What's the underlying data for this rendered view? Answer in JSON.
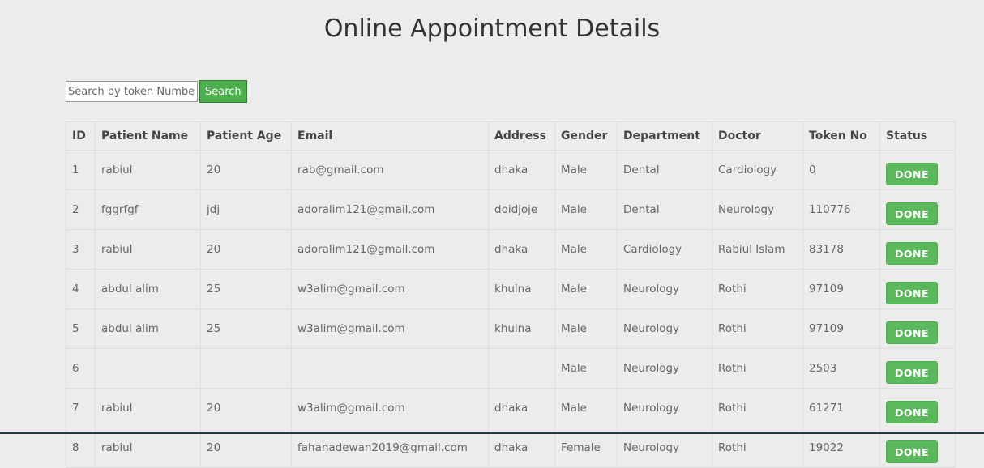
{
  "page": {
    "title": "Online Appointment Details"
  },
  "search": {
    "placeholder": "Search by token Number",
    "value": "",
    "button_label": "Search"
  },
  "table": {
    "columns": [
      "ID",
      "Patient Name",
      "Patient Age",
      "Email",
      "Address",
      "Gender",
      "Department",
      "Doctor",
      "Token No",
      "Status"
    ],
    "rows": [
      [
        "1",
        "rabiul",
        "20",
        "rab@gmail.com",
        "dhaka",
        "Male",
        "Dental",
        "Cardiology",
        "0",
        "DONE"
      ],
      [
        "2",
        "fggrfgf",
        "jdj",
        "adoralim121@gmail.com",
        "doidjoje",
        "Male",
        "Dental",
        "Neurology",
        "110776",
        "DONE"
      ],
      [
        "3",
        "rabiul",
        "20",
        "adoralim121@gmail.com",
        "dhaka",
        "Male",
        "Cardiology",
        "Rabiul Islam",
        "83178",
        "DONE"
      ],
      [
        "4",
        "abdul alim",
        "25",
        "w3alim@gmail.com",
        "khulna",
        "Male",
        "Neurology",
        "Rothi",
        "97109",
        "DONE"
      ],
      [
        "5",
        "abdul alim",
        "25",
        "w3alim@gmail.com",
        "khulna",
        "Male",
        "Neurology",
        "Rothi",
        "97109",
        "DONE"
      ],
      [
        "6",
        "",
        "",
        "",
        "",
        "Male",
        "Neurology",
        "Rothi",
        "2503",
        "DONE"
      ],
      [
        "7",
        "rabiul",
        "20",
        "w3alim@gmail.com",
        "dhaka",
        "Male",
        "Neurology",
        "Rothi",
        "61271",
        "DONE"
      ],
      [
        "8",
        "rabiul",
        "20",
        "fahanadewan2019@gmail.com",
        "dhaka",
        "Female",
        "Neurology",
        "Rothi",
        "19022",
        "DONE"
      ]
    ]
  },
  "colors": {
    "background": "#ececec",
    "done_button": "#5cb85c",
    "search_button": "#4cae4c"
  }
}
